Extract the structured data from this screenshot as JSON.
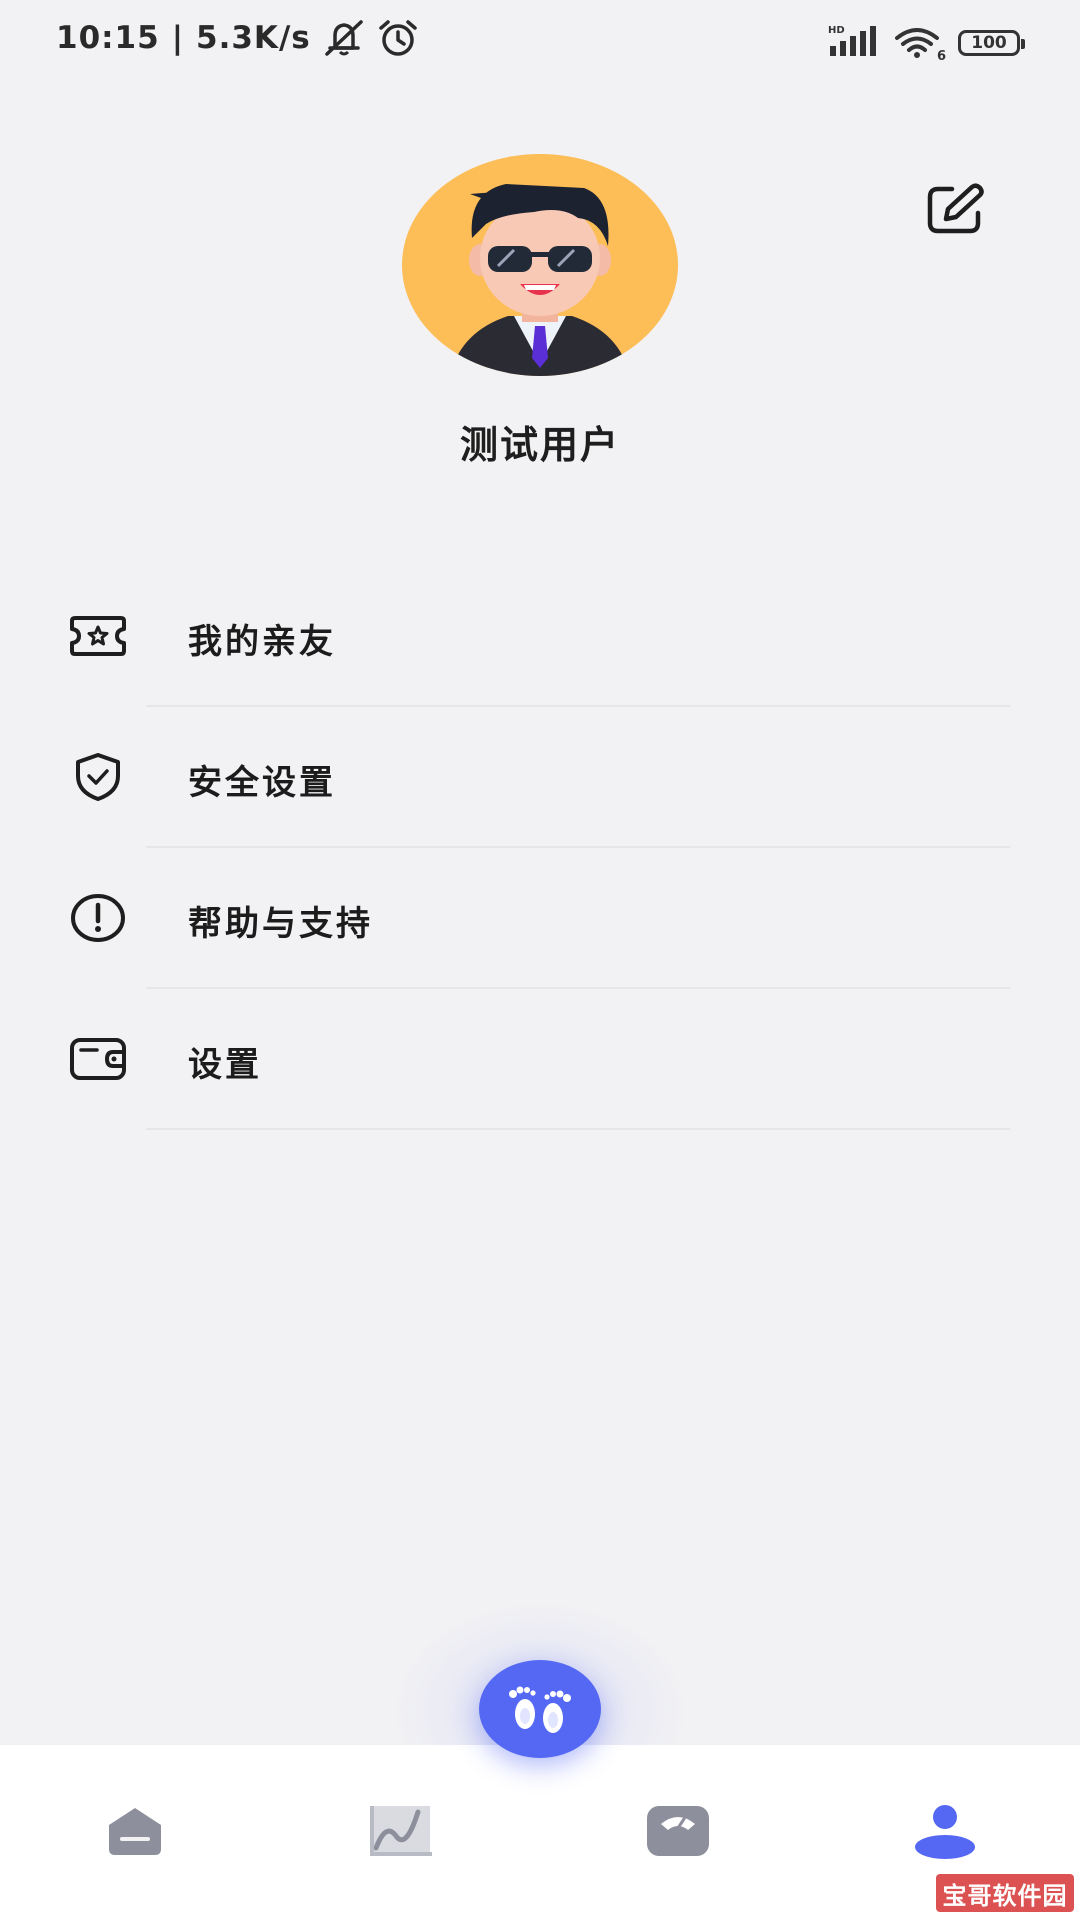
{
  "status_bar": {
    "time": "10:15",
    "separator": "|",
    "network_speed": "5.3K/s",
    "network_type": "HD",
    "wifi_badge": "6",
    "battery": "100",
    "icons": [
      "bell-muted-icon",
      "alarm-icon",
      "signal-icon",
      "wifi-icon",
      "battery-icon"
    ]
  },
  "profile": {
    "username": "测试用户",
    "avatar": "avatar-sunglasses-man",
    "avatar_bg_color": "#fdbd57",
    "edit_icon": "edit-icon"
  },
  "menu": {
    "items": [
      {
        "label": "我的亲友",
        "icon": "ticket-star-icon"
      },
      {
        "label": "安全设置",
        "icon": "shield-check-icon"
      },
      {
        "label": "帮助与支持",
        "icon": "exclamation-circle-icon"
      },
      {
        "label": "设置",
        "icon": "wallet-icon"
      }
    ]
  },
  "fab": {
    "icon": "footprints-icon",
    "color": "#5468f4"
  },
  "bottom_nav": {
    "items": [
      {
        "name": "home",
        "icon": "home-icon",
        "active": false
      },
      {
        "name": "trend",
        "icon": "chart-icon",
        "active": false
      },
      {
        "name": "scale",
        "icon": "scale-icon",
        "active": false
      },
      {
        "name": "profile",
        "icon": "person-icon",
        "active": true
      }
    ],
    "active_color": "#5468f4",
    "inactive_color": "#8d8f9c"
  },
  "watermark": {
    "text": "宝哥软件园"
  }
}
